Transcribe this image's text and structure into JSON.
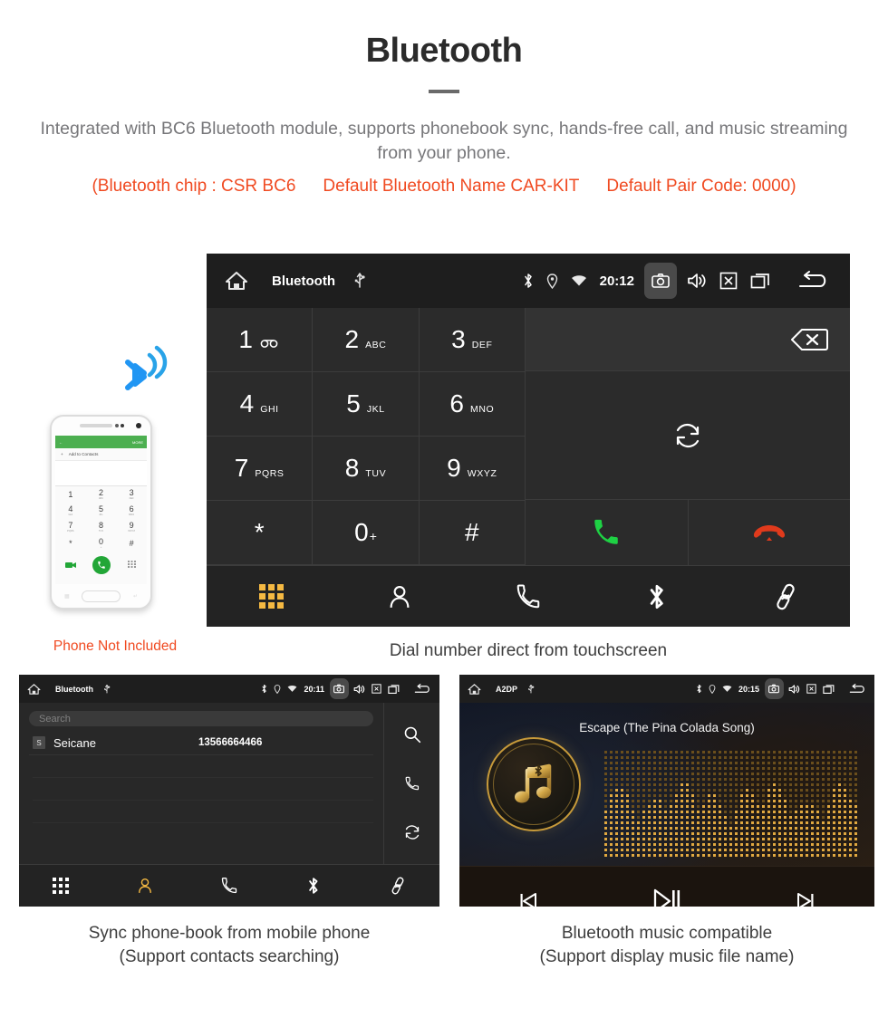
{
  "header": {
    "title": "Bluetooth",
    "description": "Integrated with BC6 Bluetooth module, supports phonebook sync, hands-free call, and music streaming from your phone.",
    "spec_chip": "(Bluetooth chip : CSR BC6",
    "spec_name": "Default Bluetooth Name CAR-KIT",
    "spec_pair": "Default Pair Code: 0000)",
    "accent_color": "#f04a21",
    "body_color": "#77777a"
  },
  "phone_mockup": {
    "caption": "Phone Not Included",
    "screen": {
      "topbar_more": "MORE",
      "add_to_contacts": "Add to Contacts",
      "keys": [
        {
          "digit": "1",
          "letters": ""
        },
        {
          "digit": "2",
          "letters": "ABC"
        },
        {
          "digit": "3",
          "letters": "DEF"
        },
        {
          "digit": "4",
          "letters": "GHI"
        },
        {
          "digit": "5",
          "letters": "JKL"
        },
        {
          "digit": "6",
          "letters": "MNO"
        },
        {
          "digit": "7",
          "letters": "PQRS"
        },
        {
          "digit": "8",
          "letters": "TUV"
        },
        {
          "digit": "9",
          "letters": "WXYZ"
        },
        {
          "digit": "*",
          "letters": ""
        },
        {
          "digit": "0",
          "letters": "+"
        },
        {
          "digit": "#",
          "letters": ""
        }
      ]
    }
  },
  "dialer": {
    "caption": "Dial number direct from touchscreen",
    "statusbar": {
      "title": "Bluetooth",
      "clock": "20:12",
      "left_icons": [
        "home-icon",
        "usb-icon"
      ],
      "right_icons": [
        "bluetooth-icon",
        "location-icon",
        "wifi-icon",
        "camera-icon",
        "volume-icon",
        "close-icon",
        "recents-icon",
        "back-icon"
      ]
    },
    "keypad": [
      {
        "digit": "1",
        "letters": "",
        "sub": "voicemail-icon"
      },
      {
        "digit": "2",
        "letters": "ABC",
        "sub": ""
      },
      {
        "digit": "3",
        "letters": "DEF",
        "sub": ""
      },
      {
        "digit": "4",
        "letters": "GHI",
        "sub": ""
      },
      {
        "digit": "5",
        "letters": "JKL",
        "sub": ""
      },
      {
        "digit": "6",
        "letters": "MNO",
        "sub": ""
      },
      {
        "digit": "7",
        "letters": "PQRS",
        "sub": ""
      },
      {
        "digit": "8",
        "letters": "TUV",
        "sub": ""
      },
      {
        "digit": "9",
        "letters": "WXYZ",
        "sub": ""
      },
      {
        "digit": "*",
        "letters": "",
        "sub": ""
      },
      {
        "digit": "0",
        "letters": "",
        "sub": "+"
      },
      {
        "digit": "#",
        "letters": "",
        "sub": ""
      }
    ],
    "number_value": "",
    "call_color": "#1ed144",
    "hangup_color": "#e03a1c",
    "nav": [
      {
        "name": "keypad",
        "icon": "keypad-grid-icon",
        "active": true
      },
      {
        "name": "contacts",
        "icon": "contacts-person-icon",
        "active": false
      },
      {
        "name": "call-log",
        "icon": "phone-handset-icon",
        "active": false
      },
      {
        "name": "bluetooth",
        "icon": "bluetooth-icon",
        "active": false
      },
      {
        "name": "pair",
        "icon": "link-chain-icon",
        "active": false
      }
    ],
    "nav_active_color": "#f5b942"
  },
  "contacts": {
    "caption_line1": "Sync phone-book from mobile phone",
    "caption_line2": "(Support contacts searching)",
    "statusbar": {
      "title": "Bluetooth",
      "clock": "20:11"
    },
    "search_placeholder": "Search",
    "rows": [
      {
        "initial": "S",
        "name": "Seicane",
        "number": "13566664466"
      }
    ],
    "side_icons": [
      "search-icon",
      "phone-handset-icon",
      "sync-icon"
    ],
    "nav": [
      {
        "name": "keypad",
        "icon": "keypad-grid-icon",
        "active": false
      },
      {
        "name": "contacts",
        "icon": "contacts-person-icon",
        "active": true
      },
      {
        "name": "call-log",
        "icon": "phone-handset-icon",
        "active": false
      },
      {
        "name": "bluetooth",
        "icon": "bluetooth-icon",
        "active": false
      },
      {
        "name": "pair",
        "icon": "link-chain-icon",
        "active": false
      }
    ]
  },
  "music": {
    "caption_line1": "Bluetooth music compatible",
    "caption_line2": "(Support display music file name)",
    "statusbar": {
      "title": "A2DP",
      "clock": "20:15"
    },
    "song_title": "Escape (The Pina Colada Song)",
    "controls": [
      "previous-track-icon",
      "play-pause-icon",
      "next-track-icon"
    ],
    "accent_color": "#e0a840"
  }
}
